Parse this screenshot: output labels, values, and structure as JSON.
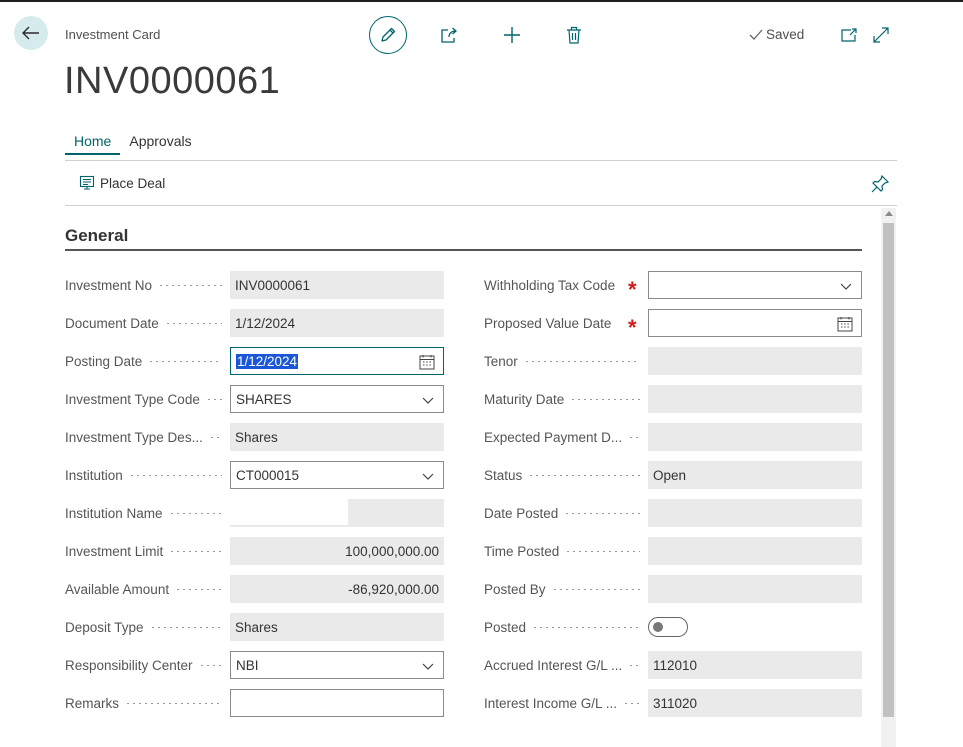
{
  "header": {
    "breadcrumb": "Investment Card",
    "title": "INV0000061",
    "saved_label": "Saved"
  },
  "toolbar": {
    "icons": [
      "pencil-icon",
      "share-icon",
      "plus-icon",
      "trash-icon",
      "open-new-window-icon",
      "expand-icon"
    ]
  },
  "tabs": [
    {
      "label": "Home",
      "active": true
    },
    {
      "label": "Approvals",
      "active": false
    }
  ],
  "actions": {
    "place_deal": "Place Deal"
  },
  "section": {
    "title": "General"
  },
  "left_fields": {
    "investment_no": {
      "label": "Investment No",
      "value": "INV0000061"
    },
    "document_date": {
      "label": "Document Date",
      "value": "1/12/2024"
    },
    "posting_date": {
      "label": "Posting Date",
      "value": "1/12/2024"
    },
    "investment_type_code": {
      "label": "Investment Type Code",
      "value": "SHARES"
    },
    "investment_type_desc": {
      "label": "Investment Type Des...",
      "value": "Shares"
    },
    "institution": {
      "label": "Institution",
      "value": "CT000015"
    },
    "institution_name": {
      "label": "Institution Name",
      "value": ""
    },
    "investment_limit": {
      "label": "Investment Limit",
      "value": "100,000,000.00"
    },
    "available_amount": {
      "label": "Available Amount",
      "value": "-86,920,000.00"
    },
    "deposit_type": {
      "label": "Deposit Type",
      "value": "Shares"
    },
    "responsibility_center": {
      "label": "Responsibility Center",
      "value": "NBI"
    },
    "remarks": {
      "label": "Remarks",
      "value": ""
    }
  },
  "right_fields": {
    "withholding_tax_code": {
      "label": "Withholding Tax Code",
      "value": ""
    },
    "proposed_value_date": {
      "label": "Proposed Value Date",
      "value": ""
    },
    "tenor": {
      "label": "Tenor",
      "value": ""
    },
    "maturity_date": {
      "label": "Maturity Date",
      "value": ""
    },
    "expected_payment_date": {
      "label": "Expected Payment D...",
      "value": ""
    },
    "status": {
      "label": "Status",
      "value": "Open"
    },
    "date_posted": {
      "label": "Date Posted",
      "value": ""
    },
    "time_posted": {
      "label": "Time Posted",
      "value": ""
    },
    "posted_by": {
      "label": "Posted By",
      "value": ""
    },
    "posted": {
      "label": "Posted",
      "value": false
    },
    "accrued_interest_gl": {
      "label": "Accrued Interest G/L ...",
      "value": "112010"
    },
    "interest_income_gl": {
      "label": "Interest Income G/L ...",
      "value": "311020"
    }
  },
  "colors": {
    "accent": "#00656b",
    "required": "#d31d1d",
    "readonly_bg": "#eaeaea",
    "selection": "#1a56d6"
  }
}
